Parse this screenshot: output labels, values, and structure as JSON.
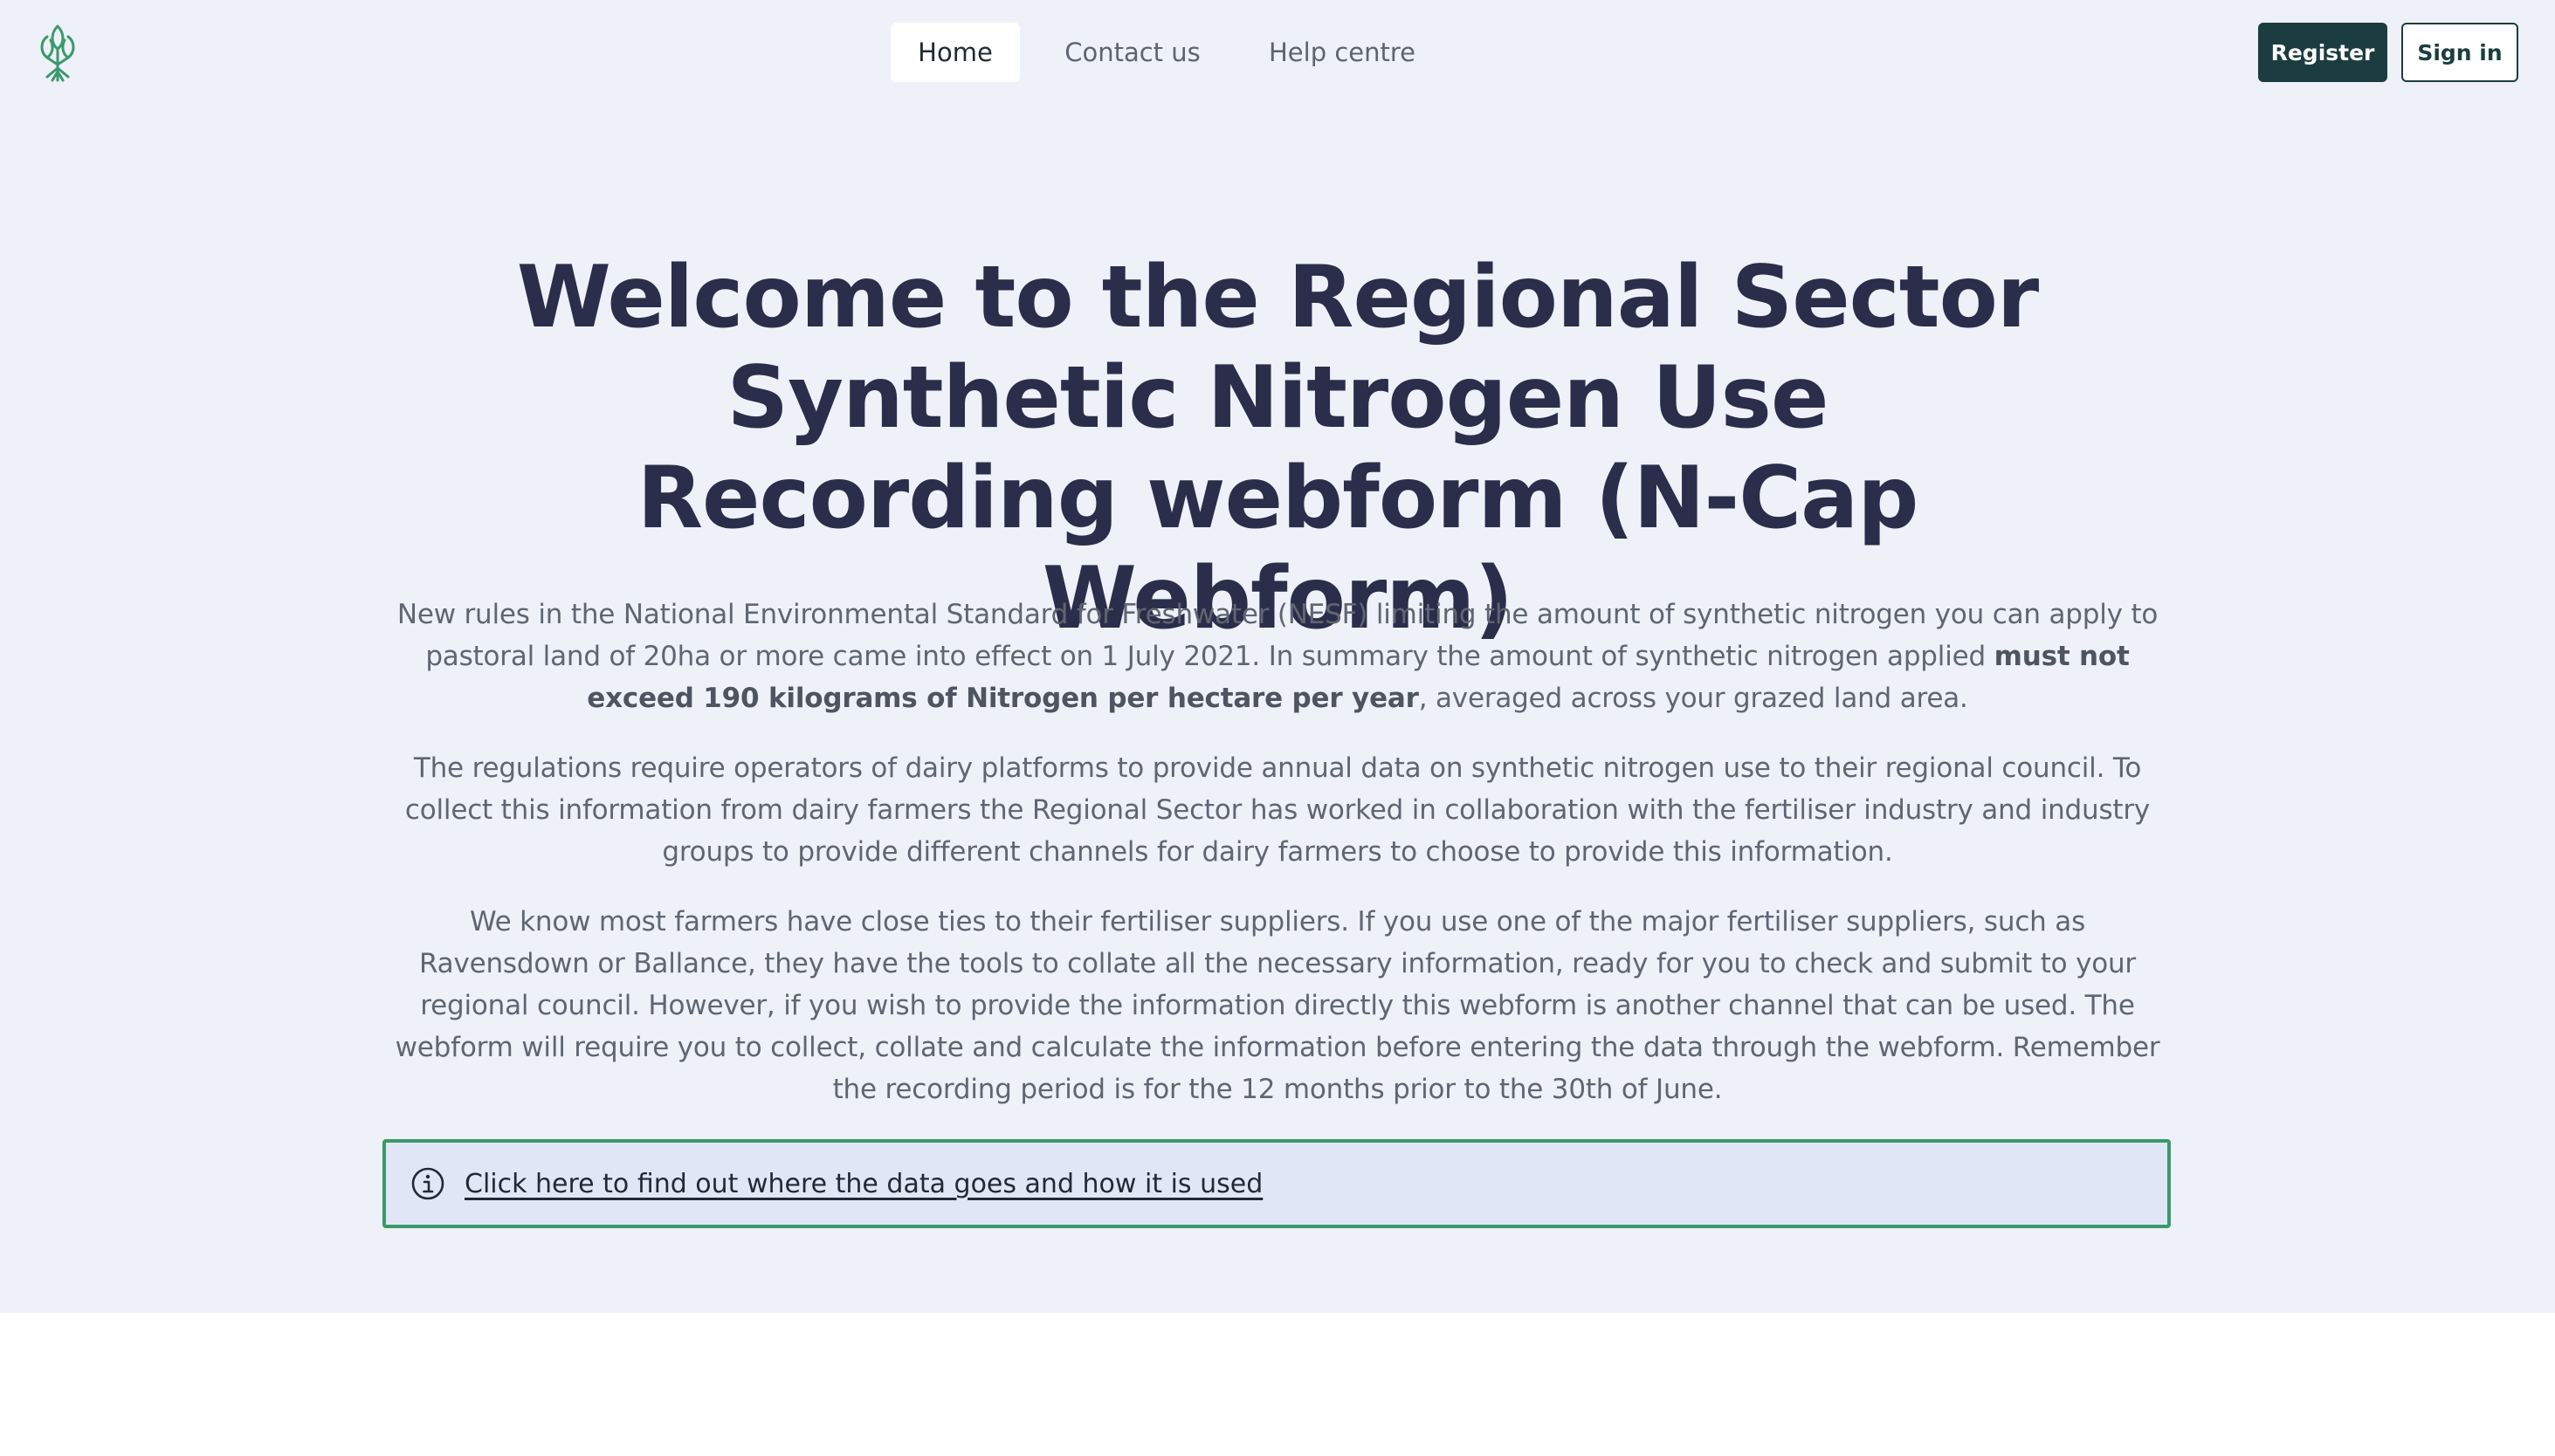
{
  "colors": {
    "hero_bg": "#eef1f8",
    "page_bg": "#ffffff",
    "heading": "#2b2e4a",
    "body_text": "#5f6672",
    "brand_dark": "#1c3d3f",
    "brand_green": "#3a9a6a",
    "info_bg": "#e1e6f7"
  },
  "header": {
    "logo_icon": "tree-logo-icon",
    "nav": [
      {
        "label": "Home",
        "active": true
      },
      {
        "label": "Contact us",
        "active": false
      },
      {
        "label": "Help centre",
        "active": false
      }
    ],
    "register_label": "Register",
    "signin_label": "Sign in"
  },
  "main": {
    "title": "Welcome to the Regional Sector Synthetic Nitrogen Use Recording webform (N-Cap Webform)",
    "para1_text": "New rules in the National Environmental Standard for Freshwater (NESF) limiting the amount of synthetic nitrogen you can apply to pastoral land of 20ha or more came into effect on 1 July 2021. In summary the amount of synthetic nitrogen applied ",
    "para1_bold": "must not exceed 190 kilograms of Nitrogen per hectare per year",
    "para1_tail": ", averaged across your grazed land area.",
    "para2": "The regulations require operators of dairy platforms to provide annual data on synthetic nitrogen use to their regional council. To collect this information from dairy farmers the Regional Sector has worked in collaboration with the fertiliser industry and industry groups to provide different channels for dairy farmers to choose to provide this information.",
    "para3": "We know most farmers have close ties to their fertiliser suppliers. If you use one of the major fertiliser suppliers, such as Ravensdown or Ballance, they have the tools to collate all the necessary information, ready for you to check and submit to your regional council. However, if you wish to provide the information directly this webform is another channel that can be used. The webform will require you to collect, collate and calculate the information before entering the data through the webform. Remember the recording period is for the 12 months prior to the 30th of June.",
    "info_icon": "info-circle-icon",
    "info_link": "Click here to find out where the data goes and how it is used"
  }
}
